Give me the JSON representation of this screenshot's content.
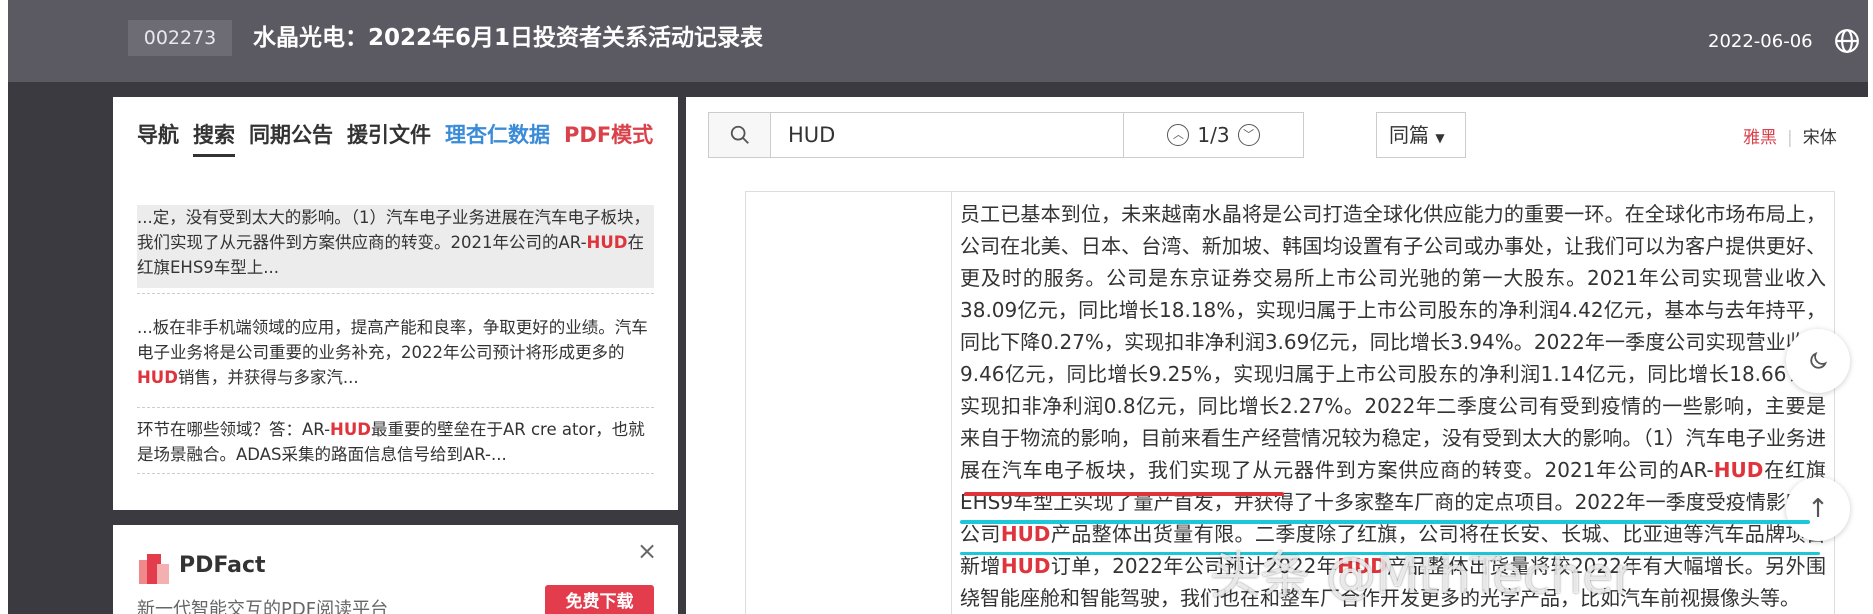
{
  "header": {
    "stock_code": "002273",
    "title": "水晶光电：2022年6月1日投资者关系活动记录表",
    "date": "2022-06-06"
  },
  "left_tabs": [
    "导航",
    "搜索",
    "同期公告",
    "援引文件",
    "理杏仁数据",
    "PDF模式"
  ],
  "results": [
    {
      "pre": "...定，没有受到太大的影响。（1）汽车电子业务进展在汽车电子板块，我们实现了从元器件到方案供应商的转变。2021年公司的AR-",
      "hl": "HUD",
      "post": "在红旗EHS9车型上..."
    },
    {
      "pre": "...板在非手机端领域的应用，提高产能和良率，争取更好的业绩。汽车电子业务将是公司重要的业务补充，2022年公司预计将形成更多的",
      "hl": "HUD",
      "post": "销售，并获得与多家汽..."
    },
    {
      "pre": "环节在哪些领域？答：AR-",
      "hl": "HUD",
      "post": "最重要的壁垒在于AR cre ator，也就是场景融合。ADAS采集的路面信息信号给到AR-..."
    }
  ],
  "ad": {
    "brand": "PDFact",
    "subtitle": "新一代智能交互的PDF阅读平台",
    "button": "免费下载",
    "close": "×"
  },
  "search": {
    "query": "HUD",
    "position": "1/3",
    "scope": "同篇",
    "font_a": "雅黑",
    "font_b": "宋体"
  },
  "doc": {
    "p1": "员工已基本到位，未来越南水晶将是公司打造全球化供应能力的重要一环。在全球化市场布局上，公司在北美、日本、台湾、新加坡、韩国均设置有子公司或办事处，让我们可以为客户提供更好、更及时的服务。公司是东京证券交易所上市公司光驰的第一大股东。2021年公司实现营业收入38.09亿元，同比增长18.18%，实现归属于上市公司股东的净利润4.42亿元，基本与去年持平，同比下降0.27%，实现扣非净利润3.69亿元，同比增长3.94%。2022年一季度公司实现营业收入9.46亿元，同比增长9.25%，实现归属于上市公司股东的净利润1.14亿元，同比增长18.66%，实现扣非净利润0.8亿元，同比增长2.27%。2022年二季度公司有受到疫情的一些影响，主要是来自于物流的影响，目前来看生产经营情况较为稳定，没有受到太大的影响。（1）汽车电子业务进展在汽车电子板块，我们实现了从元器件到方案供应商的转变。2021年公司的AR-",
    "hl1": "HUD",
    "p2": "在红旗EHS9车型上实现了量产首发，并获得了十多家整车厂商的定点项目。2022年一季度受疫情影响，公司",
    "hl2": "HUD",
    "p3": "产品整体出货量有限。二季度除了红旗，公司将在长安、长城、比亚迪等汽车品牌项目新增",
    "hl3": "HUD",
    "p4": "订单，2022年公司预计2022年",
    "hl4": "HUD",
    "p5": "产品整体出货量将较2022年有大幅增长。另外围绕智能座舱和智能驾驶，我们也在和整车厂合作开发更多的光学产品，比如汽车前视摄像头等。"
  },
  "watermark": "头条 @MthTecher",
  "colors": {
    "header_bg": "#5b5a63",
    "highlight": "#e0343c",
    "blue_tab": "#3a8bd8",
    "ad_button": "#e23c4d"
  }
}
